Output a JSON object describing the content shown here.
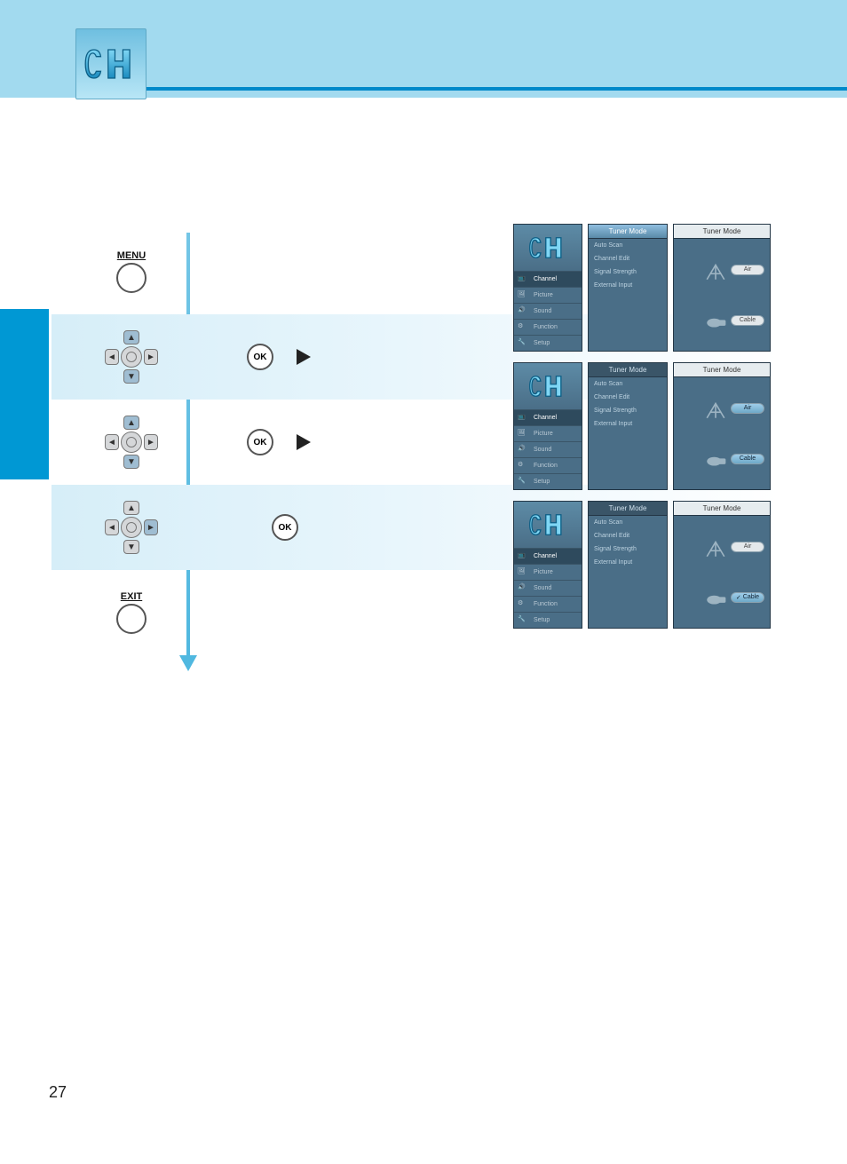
{
  "page_number": "27",
  "header": {
    "logo_text": "CH"
  },
  "remote": {
    "menu_label": "MENU",
    "exit_label": "EXIT",
    "ok_label": "OK"
  },
  "osd": {
    "nav_tabs": [
      {
        "label": "Channel"
      },
      {
        "label": "Picture"
      },
      {
        "label": "Sound"
      },
      {
        "label": "Function"
      },
      {
        "label": "Setup"
      }
    ],
    "list_header": "Tuner Mode",
    "list_items": [
      "Auto Scan",
      "Channel Edit",
      "Signal Strength",
      "External Input"
    ],
    "detail_header": "Tuner Mode",
    "option_air": "Air",
    "option_cable": "Cable"
  }
}
